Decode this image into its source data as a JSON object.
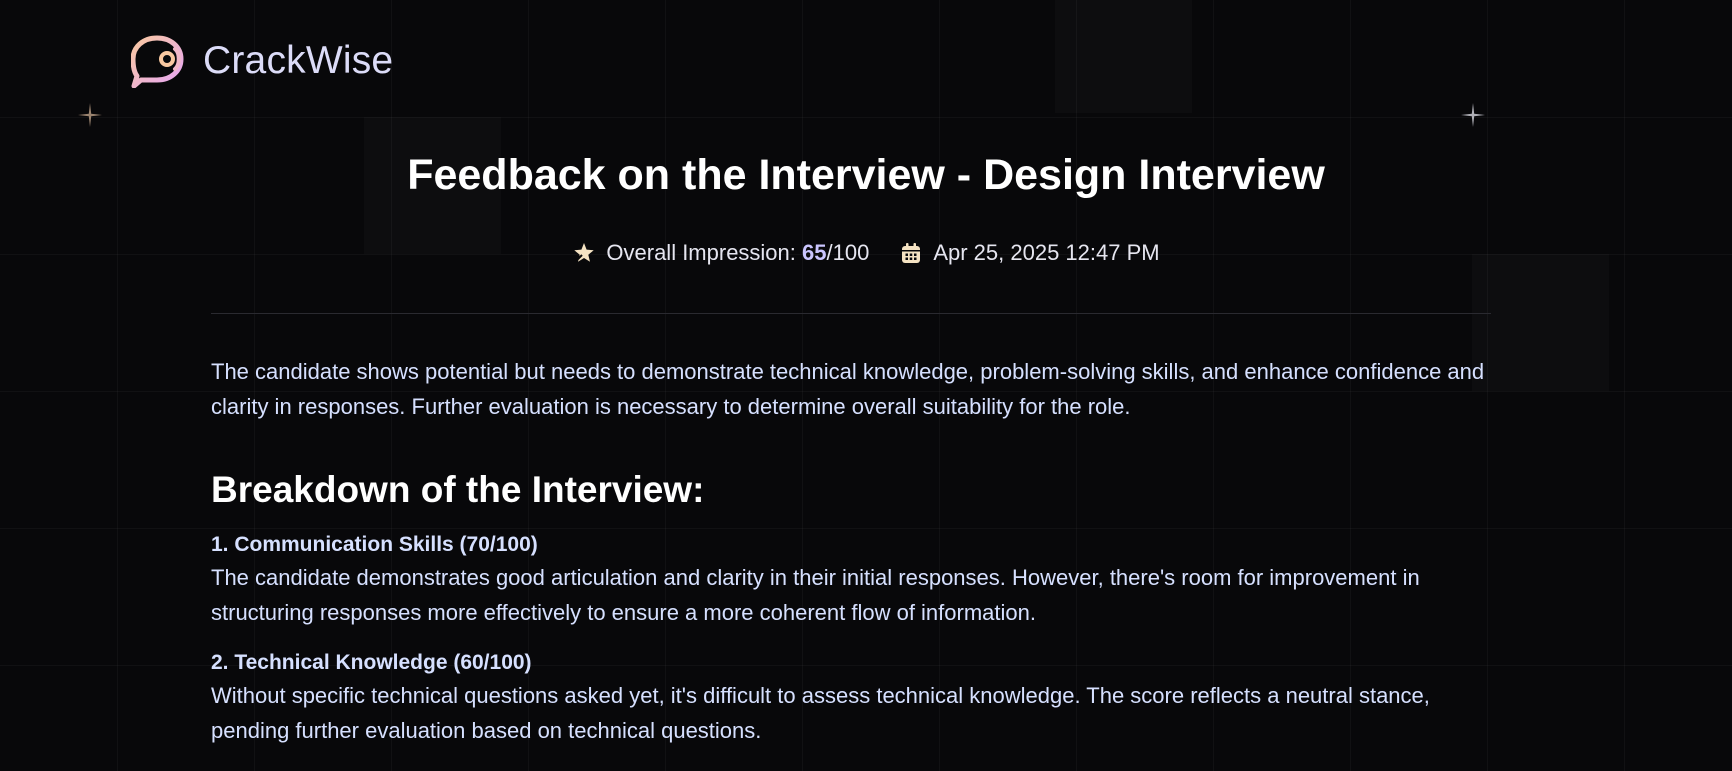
{
  "brand": {
    "name": "CrackWise"
  },
  "page": {
    "title": "Feedback on the Interview - Design Interview",
    "overall_label": "Overall Impression: ",
    "overall_score": "65",
    "overall_total": "/100",
    "date": "Apr 25, 2025 12:47 PM"
  },
  "summary": "The candidate shows potential but needs to demonstrate technical knowledge, problem-solving skills, and enhance confidence and clarity in responses. Further evaluation is necessary to determine overall suitability for the role.",
  "breakdown": {
    "title": "Breakdown of the Interview:",
    "items": [
      {
        "heading": "1. Communication Skills (70/100)",
        "text": "The candidate demonstrates good articulation and clarity in their initial responses. However, there's room for improvement in structuring responses more effectively to ensure a more coherent flow of information."
      },
      {
        "heading": "2. Technical Knowledge (60/100)",
        "text": "Without specific technical questions asked yet, it's difficult to assess technical knowledge. The score reflects a neutral stance, pending further evaluation based on technical questions."
      }
    ]
  },
  "colors": {
    "background": "#08080a",
    "accent": "#cac5fe",
    "logo_gradient_start": "#f9c8a0",
    "logo_gradient_end": "#e6a6f5",
    "icon_star": "#f5e3c3"
  },
  "icons": {
    "logo": "chat-bubble-logo-icon",
    "score": "star-icon",
    "date": "calendar-icon"
  }
}
